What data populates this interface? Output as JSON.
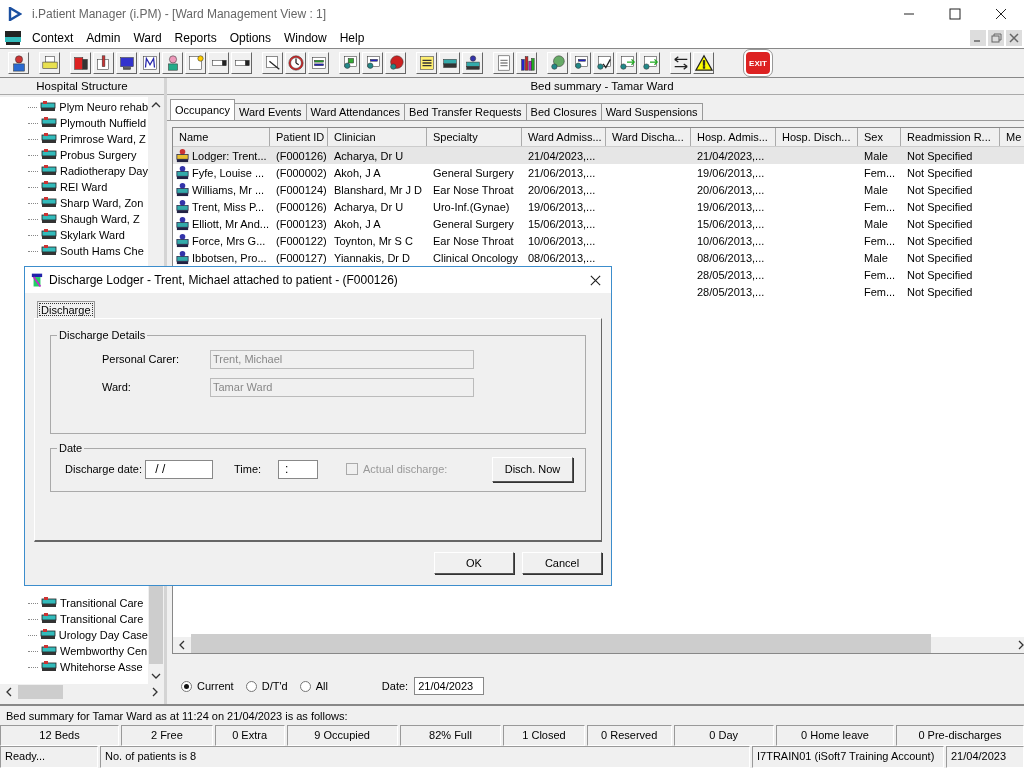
{
  "window": {
    "title": "i.Patient Manager (i.PM) - [Ward Management View : 1]"
  },
  "menu": [
    "Context",
    "Admin",
    "Ward",
    "Reports",
    "Options",
    "Window",
    "Help"
  ],
  "toolbar": {
    "exit_label": "EXIT"
  },
  "left_panel": {
    "title": "Hospital Structure",
    "items_top": [
      "Plym Neuro rehab",
      "Plymouth Nuffield",
      "Primrose Ward, Z",
      "Probus Surgery",
      "Radiotherapy Day",
      "REI Ward",
      "Sharp Ward, Zon",
      "Shaugh Ward, Z",
      "Skylark Ward",
      "South Hams Che"
    ],
    "items_bottom": [
      "Transitional Care",
      "Transitional Care",
      "Urology Day Case",
      "Wembworthy Cen",
      "Whitehorse Asse"
    ]
  },
  "main": {
    "title": "Bed summary - Tamar Ward",
    "tabs": [
      {
        "label": "Occupancy",
        "selected": true
      },
      {
        "label": "Ward Events",
        "selected": false
      },
      {
        "label": "Ward Attendances",
        "selected": false
      },
      {
        "label": "Bed Transfer Requests",
        "selected": false
      },
      {
        "label": "Bed Closures",
        "selected": false
      },
      {
        "label": "Ward Suspensions",
        "selected": false
      }
    ],
    "columns": [
      "Name",
      "Patient ID",
      "Clinician",
      "Specialty",
      "Ward Admiss...",
      "Ward Discha...",
      "Hosp. Admis...",
      "Hosp. Disch...",
      "Sex",
      "Readmission R...",
      "Me"
    ],
    "rows": [
      {
        "kind": "lodger",
        "selected": true,
        "cells": [
          "Lodger: Trent...",
          "(F000126)",
          "Acharya, Dr U",
          null,
          "21/04/2023,...",
          null,
          "21/04/2023,...",
          null,
          "Male",
          "Not Specified"
        ]
      },
      {
        "kind": "patient",
        "selected": false,
        "cells": [
          "Fyfe, Louise ...",
          "(F000002)",
          "Akoh, J A",
          "General Surgery",
          "21/06/2013,...",
          null,
          "19/06/2013,...",
          null,
          "Fem...",
          "Not Specified"
        ]
      },
      {
        "kind": "patient",
        "selected": false,
        "cells": [
          "Williams, Mr ...",
          "(F000124)",
          "Blanshard, Mr J D",
          "Ear Nose Throat",
          "20/06/2013,...",
          null,
          "20/06/2013,...",
          null,
          "Male",
          "Not Specified"
        ]
      },
      {
        "kind": "patient",
        "selected": false,
        "cells": [
          "Trent, Miss P...",
          "(F000126)",
          "Acharya, Dr U",
          "Uro-Inf.(Gynae)",
          "19/06/2013,...",
          null,
          "19/06/2013,...",
          null,
          "Fem...",
          "Not Specified"
        ]
      },
      {
        "kind": "patient",
        "selected": false,
        "cells": [
          "Elliott, Mr And...",
          "(F000123)",
          "Akoh, J A",
          "General Surgery",
          "15/06/2013,...",
          null,
          "15/06/2013,...",
          null,
          "Male",
          "Not Specified"
        ]
      },
      {
        "kind": "patient",
        "selected": false,
        "cells": [
          "Force, Mrs G...",
          "(F000122)",
          "Toynton, Mr S C",
          "Ear Nose Throat",
          "10/06/2013,...",
          null,
          "10/06/2013,...",
          null,
          "Fem...",
          "Not Specified"
        ]
      },
      {
        "kind": "patient",
        "selected": false,
        "cells": [
          "Ibbotsen, Pro...",
          "(F000127)",
          "Yiannakis, Dr D",
          "Clinical Oncology",
          "08/06/2013,...",
          null,
          "08/06/2013,...",
          null,
          "Male",
          "Not Specified"
        ]
      },
      {
        "selected": false,
        "cells": [
          null,
          null,
          null,
          null,
          null,
          null,
          "28/05/2013,...",
          null,
          "Fem...",
          "Not Specified"
        ]
      },
      {
        "selected": false,
        "cells": [
          null,
          null,
          null,
          null,
          null,
          null,
          "28/05/2013,...",
          null,
          "Fem...",
          "Not Specified"
        ]
      }
    ],
    "filters": [
      {
        "label": "Current",
        "selected": true
      },
      {
        "label": "D/T'd",
        "selected": false
      },
      {
        "label": "All",
        "selected": false
      }
    ],
    "date_label": "Date:",
    "date_value": "21/04/2023"
  },
  "summary_line": "Bed summary for Tamar Ward as at 11:24 on 21/04/2023 is as follows:",
  "summary_cells": [
    "12 Beds",
    "2 Free",
    "0 Extra",
    "9 Occupied",
    "82% Full",
    "1 Closed",
    "0 Reserved",
    "0 Day",
    "0 Home leave",
    "0 Pre-discharges"
  ],
  "status_bar": [
    "Ready...",
    "No. of patients is 8",
    "I7TRAIN01 (iSoft7 Training Account)",
    "21/04/2023"
  ],
  "dialog": {
    "title": "Discharge Lodger - Trent, Michael attached to patient - (F000126)",
    "tab": {
      "label": "Discharge",
      "selected": true
    },
    "details_group": "Discharge Details",
    "personal_carer": {
      "label": "Personal Carer:",
      "value": "Trent, Michael",
      "disabled": true
    },
    "ward": {
      "label": "Ward:",
      "value": "Tamar Ward",
      "disabled": true
    },
    "date_group": "Date",
    "discharge_date": {
      "label": "Discharge date:",
      "value": " / /"
    },
    "time": {
      "label": "Time:",
      "value": ":"
    },
    "actual_discharge": {
      "label": "Actual discharge:",
      "checked": false,
      "disabled": true
    },
    "buttons": [
      "Disch. Now",
      "OK",
      "Cancel"
    ]
  }
}
